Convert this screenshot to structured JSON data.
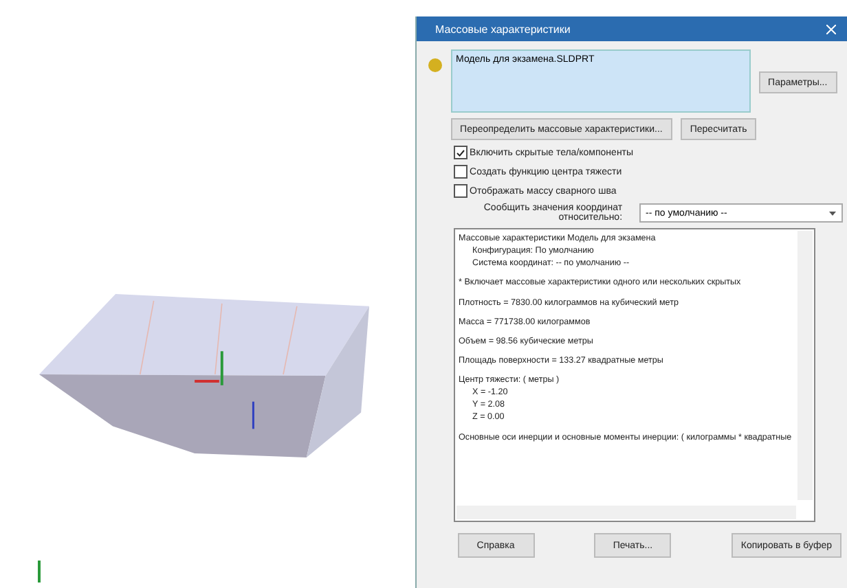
{
  "dialog": {
    "title": "Массовые характеристики",
    "selection": "Модель для экзамена.SLDPRT",
    "options_button": "Параметры...",
    "override_button": "Переопределить массовые характеристики...",
    "recalc_button": "Пересчитать",
    "checkboxes": [
      {
        "label": "Включить скрытые тела/компоненты",
        "checked": true
      },
      {
        "label": "Создать функцию центра тяжести",
        "checked": false
      },
      {
        "label": "Отображать массу сварного шва",
        "checked": false
      }
    ],
    "coord_label": "Сообщить значения координат относительно:",
    "coord_value": "-- по умолчанию --",
    "report": [
      {
        "text": "Массовые характеристики Модель для экзамена",
        "children": [
          {
            "text": "Конфигурация: По умолчанию"
          },
          {
            "text": "Система координат: -- по умолчанию --"
          }
        ]
      },
      {
        "text": "* Включает массовые характеристики одного или нескольких скрытых"
      },
      {
        "text": "Плотность = 7830.00 килограммов на кубический метр"
      },
      {
        "text": "Масса = 771738.00 килограммов"
      },
      {
        "text": "Объем = 98.56 кубические метры"
      },
      {
        "text": "Площадь поверхности = 133.27 квадратные метры"
      },
      {
        "text": "Центр тяжести: ( метры )",
        "children": [
          {
            "text": "X = -1.20"
          },
          {
            "text": "Y = 2.08"
          },
          {
            "text": "Z = 0.00"
          }
        ]
      },
      {
        "text": "Основные оси инерции и основные моменты инерции: ( килограммы * квадратные"
      }
    ],
    "buttons": [
      "Справка",
      "Печать...",
      "Копировать в буфер"
    ]
  }
}
